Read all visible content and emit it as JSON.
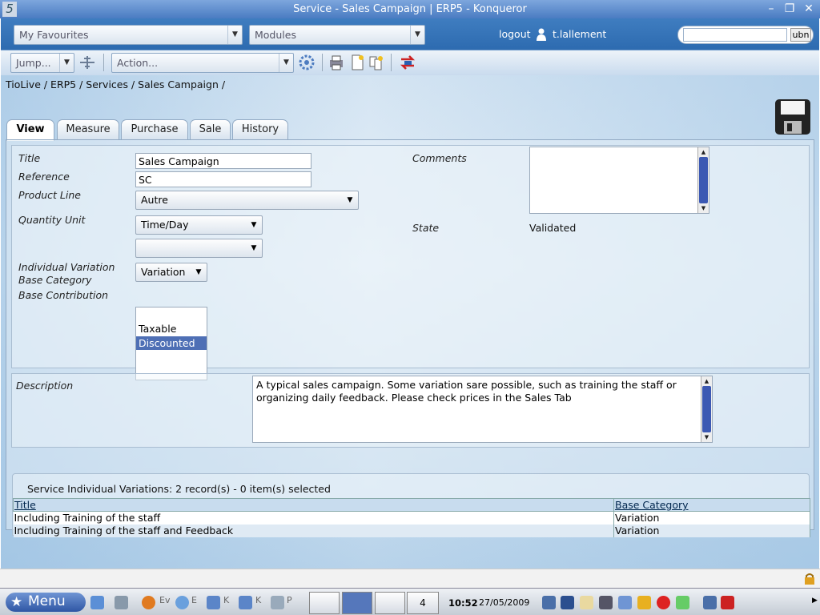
{
  "window": {
    "title": "Service - Sales Campaign | ERP5 - Konqueror",
    "app_icon": "5"
  },
  "topbar": {
    "favourites": "My Favourites",
    "modules": "Modules",
    "logout": "logout",
    "user": "t.lallement",
    "search_value": "",
    "search_button": "ubn"
  },
  "toolbar": {
    "jump": "Jump...",
    "action": "Action..."
  },
  "breadcrumb": "TioLive / ERP5 / Services / Sales Campaign /",
  "tabs": [
    "View",
    "Measure",
    "Purchase",
    "Sale",
    "History"
  ],
  "form": {
    "title_label": "Title",
    "title_value": "Sales Campaign",
    "reference_label": "Reference",
    "reference_value": "SC",
    "product_line_label": "Product Line",
    "product_line_value": "Autre",
    "quantity_unit_label": "Quantity Unit",
    "quantity_unit_value": "Time/Day",
    "quantity_unit_value2": "",
    "ivbc_label_1": "Individual Variation",
    "ivbc_label_2": "Base Category",
    "ivbc_value": "Variation",
    "base_contribution_label": "Base Contribution",
    "base_contribution_options": [
      "Taxable",
      "Discounted"
    ],
    "comments_label": "Comments",
    "comments_value": "",
    "state_label": "State",
    "state_value": "Validated",
    "description_label": "Description",
    "description_value": "A typical sales campaign. Some variation sare possible, such as training the staff or organizing daily feedback. Please check prices in the Sales Tab"
  },
  "listbox": {
    "title": "Service Individual Variations: 2 record(s) - 0 item(s) selected",
    "columns": [
      "Title",
      "Base Category"
    ],
    "rows": [
      [
        "Including Training of the staff",
        "Variation"
      ],
      [
        "Including Training of the staff and Feedback",
        "Variation"
      ]
    ]
  },
  "taskbar": {
    "menu": "Menu",
    "tasks": [
      "Ev",
      "E",
      "K",
      "K",
      "P"
    ],
    "desktop": "4",
    "time": "10:52",
    "date": "27/05/2009"
  },
  "colors": {
    "titlebar": "#4a7cc2",
    "topbar": "#2d6bb0",
    "selection": "#4e6fb5",
    "scroll_thumb": "#3c59b3"
  }
}
